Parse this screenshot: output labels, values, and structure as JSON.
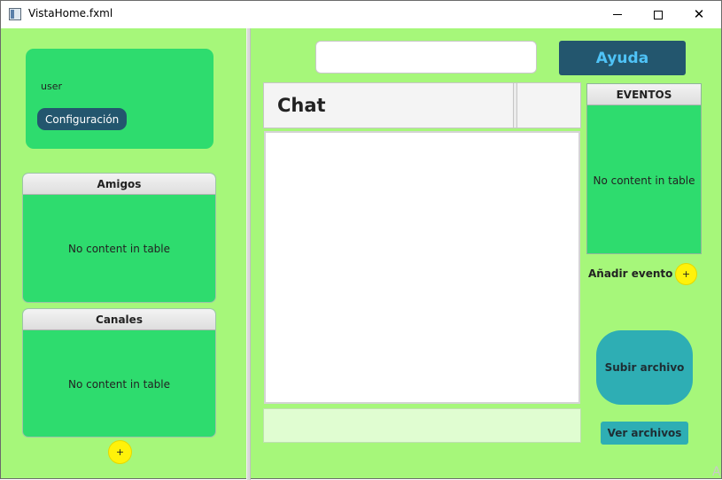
{
  "window": {
    "title": "VistaHome.fxml",
    "controls": {
      "minimize": "minimize-icon",
      "maximize": "maximize-icon",
      "close": "✕"
    }
  },
  "user_panel": {
    "username": "user",
    "config_label": "Configuración"
  },
  "tables": {
    "amigos": {
      "header": "Amigos",
      "empty_text": "No content in table"
    },
    "canales": {
      "header": "Canales",
      "empty_text": "No content in table"
    },
    "eventos": {
      "header": "EVENTOS",
      "empty_text": "No content in table"
    }
  },
  "add_button_label": "+",
  "search": {
    "value": "",
    "placeholder": ""
  },
  "help_button": {
    "label": "Ayuda"
  },
  "chat": {
    "title": "Chat",
    "input_value": ""
  },
  "events": {
    "add_label": "Añadir evento"
  },
  "files": {
    "upload_label": "Subir archivo",
    "view_label": "Ver archivos"
  },
  "colors": {
    "background": "#a6f77a",
    "panel_green": "#2edc6e",
    "dark_teal": "#23566e",
    "help_text": "#4fc3f7",
    "file_buttons": "#2eaeb4",
    "plus_yellow": "#fff20a",
    "chat_input_bg": "#e0fdd1"
  }
}
